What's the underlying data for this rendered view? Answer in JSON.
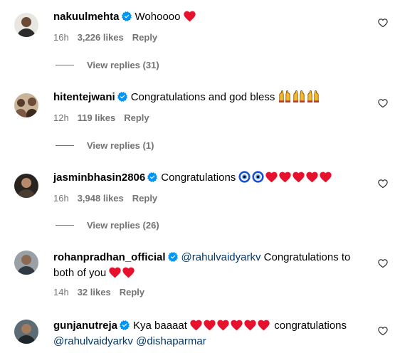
{
  "comments": [
    {
      "username": "nakuulmehta",
      "text": "Wohoooo",
      "emojis": [
        "red-heart"
      ],
      "time": "16h",
      "likes": "3,226 likes",
      "reply": "Reply",
      "view_replies": "View replies (31)"
    },
    {
      "username": "hitentejwani",
      "text": "Congratulations and god bless",
      "emojis": [
        "raising-hands",
        "raising-hands",
        "raising-hands"
      ],
      "time": "12h",
      "likes": "119 likes",
      "reply": "Reply",
      "view_replies": "View replies (1)"
    },
    {
      "username": "jasminbhasin2806",
      "text": "Congratulations",
      "emojis": [
        "nazar-amulet",
        "nazar-amulet",
        "red-heart",
        "red-heart",
        "red-heart",
        "red-heart",
        "red-heart"
      ],
      "time": "16h",
      "likes": "3,948 likes",
      "reply": "Reply",
      "view_replies": "View replies (26)"
    },
    {
      "username": "rohanpradhan_official",
      "mention": "@rahulvaidyarkv",
      "text": "Congratulations to both of you",
      "emojis": [
        "red-heart",
        "red-heart"
      ],
      "time": "14h",
      "likes": "32 likes",
      "reply": "Reply"
    },
    {
      "username": "gunjanutreja",
      "text": "Kya baaaat",
      "emojis": [
        "red-heart",
        "red-heart",
        "red-heart",
        "red-heart",
        "red-heart",
        "red-heart"
      ],
      "text_after": "congratulations",
      "mention_1": "@rahulvaidyarkv",
      "mention_2": "@dishaparmar"
    }
  ],
  "colors": {
    "verified": "#0095f6",
    "secondary_text": "#737373",
    "mention": "#00376b",
    "heart": "#ff3040"
  }
}
